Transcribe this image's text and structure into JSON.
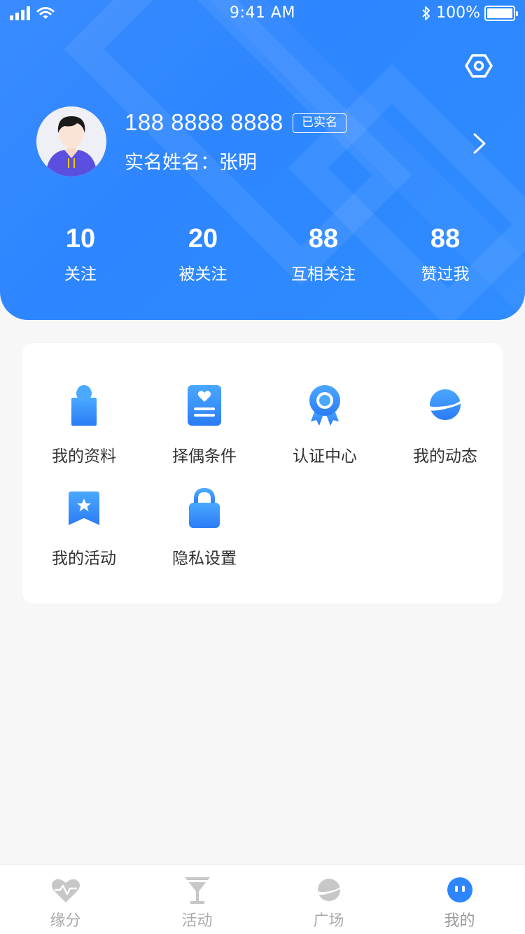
{
  "status_bar": {
    "time": "9:41 AM",
    "battery": "100%"
  },
  "profile": {
    "phone": "188 8888 8888",
    "verified_badge": "已实名",
    "realname": "实名姓名：张明"
  },
  "stats": [
    {
      "value": "10",
      "label": "关注"
    },
    {
      "value": "20",
      "label": "被关注"
    },
    {
      "value": "88",
      "label": "互相关注"
    },
    {
      "value": "88",
      "label": "赞过我"
    }
  ],
  "menu": [
    {
      "label": "我的资料",
      "icon": "person-icon"
    },
    {
      "label": "择偶条件",
      "icon": "heart-card-icon"
    },
    {
      "label": "认证中心",
      "icon": "award-badge-icon"
    },
    {
      "label": "我的动态",
      "icon": "planet-icon"
    },
    {
      "label": "我的活动",
      "icon": "star-bookmark-icon"
    },
    {
      "label": "隐私设置",
      "icon": "lock-icon"
    }
  ],
  "tabs": [
    {
      "label": "缘分",
      "icon": "heartbeat-icon",
      "active": false
    },
    {
      "label": "活动",
      "icon": "cocktail-icon",
      "active": false
    },
    {
      "label": "广场",
      "icon": "planet-icon",
      "active": false
    },
    {
      "label": "我的",
      "icon": "face-icon",
      "active": true
    }
  ],
  "colors": {
    "primary": "#2e86ff",
    "icon_gradient_top": "#4aa3ff",
    "icon_gradient_bottom": "#2b7cf6",
    "tab_inactive": "#c7c7c7"
  }
}
